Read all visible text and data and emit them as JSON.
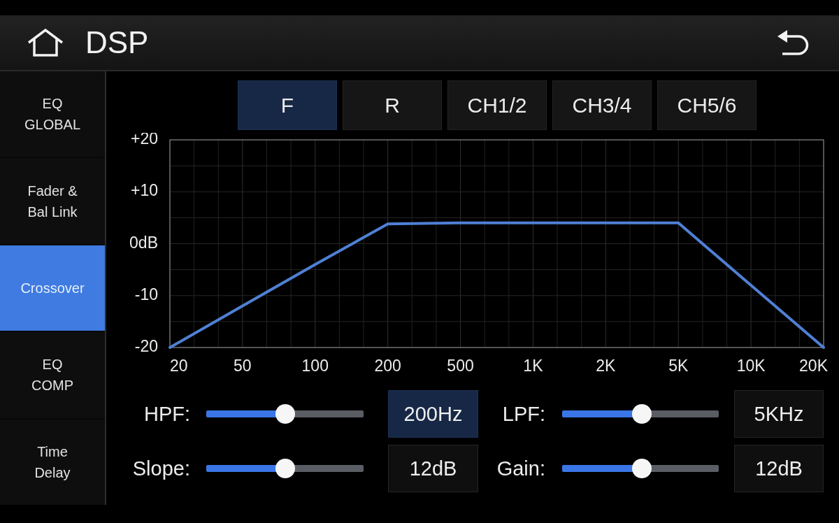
{
  "header": {
    "title": "DSP"
  },
  "sidebar": {
    "items": [
      {
        "label": "EQ\nGLOBAL",
        "selected": false
      },
      {
        "label": "Fader &\nBal Link",
        "selected": false
      },
      {
        "label": "Crossover",
        "selected": true
      },
      {
        "label": "EQ\nCOMP",
        "selected": false
      },
      {
        "label": "Time\nDelay",
        "selected": false
      }
    ]
  },
  "tabs": [
    {
      "label": "F",
      "selected": true
    },
    {
      "label": "R",
      "selected": false
    },
    {
      "label": "CH1/2",
      "selected": false
    },
    {
      "label": "CH3/4",
      "selected": false
    },
    {
      "label": "CH5/6",
      "selected": false
    }
  ],
  "response_chart": {
    "chart_data": {
      "type": "line",
      "grid": true,
      "categories": [
        "20",
        "50",
        "100",
        "200",
        "500",
        "1K",
        "2K",
        "5K",
        "10K",
        "20K"
      ],
      "series": [
        {
          "color": "#4f80d4",
          "values": [
            -20,
            -12,
            -4,
            3.8,
            4,
            4,
            4,
            4,
            -8,
            -20
          ]
        }
      ],
      "ylim": [
        -20,
        20
      ],
      "yticks": [
        {
          "value": 20,
          "label": "+20"
        },
        {
          "value": 10,
          "label": "+10"
        },
        {
          "value": 0,
          "label": "0dB"
        },
        {
          "value": -10,
          "label": "-10"
        },
        {
          "value": -20,
          "label": "-20"
        }
      ]
    }
  },
  "controls": [
    {
      "label": "HPF:",
      "level": 0.5,
      "value": "200Hz",
      "selected": true
    },
    {
      "label": "LPF:",
      "level": 0.51,
      "value": "5KHz",
      "selected": false
    },
    {
      "label": "Slope:",
      "level": 0.5,
      "value": "12dB",
      "selected": false
    },
    {
      "label": "Gain:",
      "level": 0.51,
      "value": "12dB",
      "selected": false
    }
  ]
}
